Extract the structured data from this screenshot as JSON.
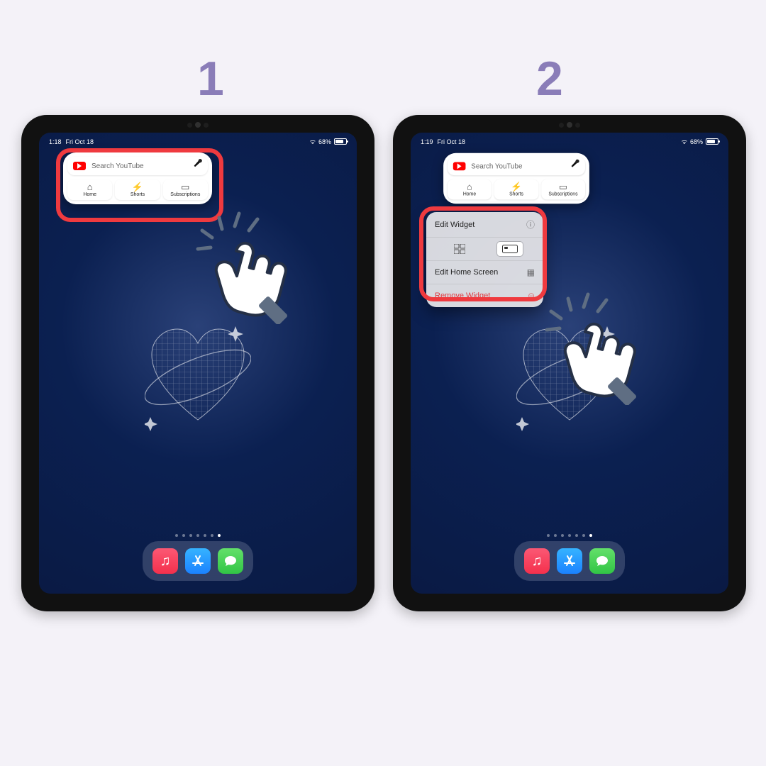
{
  "steps": {
    "one": "1",
    "two": "2"
  },
  "status": {
    "time1": "1:18",
    "time2": "1:19",
    "date": "Fri Oct 18",
    "battery_pct": "68%",
    "battery_fill_pct": 68
  },
  "youtube_widget": {
    "search_placeholder": "Search YouTube",
    "tabs": [
      {
        "label": "Home",
        "icon": "⌂"
      },
      {
        "label": "Shorts",
        "icon": "⚡"
      },
      {
        "label": "Subscriptions",
        "icon": "▭"
      }
    ]
  },
  "context_menu": {
    "edit_widget": "Edit Widget",
    "edit_home": "Edit Home Screen",
    "remove": "Remove Widget"
  },
  "dock": {
    "apps": [
      "Music",
      "App Store",
      "Messages"
    ]
  },
  "colors": {
    "step_number": "#8a7db8",
    "highlight": "#ef3a3f",
    "remove_red": "#e0383e"
  }
}
